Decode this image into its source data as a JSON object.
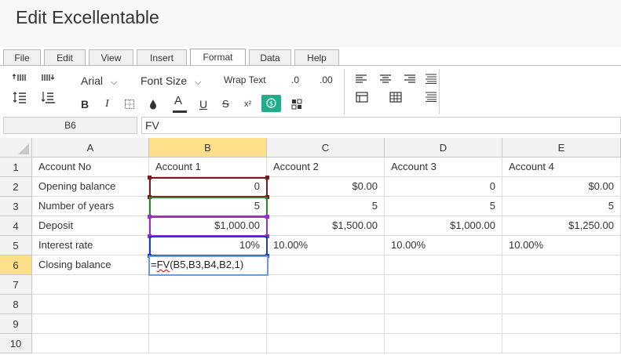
{
  "app": {
    "title": "Edit Excellentable"
  },
  "tabs": [
    {
      "label": "File"
    },
    {
      "label": "Edit"
    },
    {
      "label": "View"
    },
    {
      "label": "Insert"
    },
    {
      "label": "Format",
      "active": true
    },
    {
      "label": "Data"
    },
    {
      "label": "Help"
    }
  ],
  "ribbon": {
    "font_name": "Arial",
    "font_size": "Font Size",
    "wrap_text": "Wrap Text",
    "dec_decrease": ".0",
    "dec_increase": ".00",
    "bold": "B",
    "italic": "I",
    "text_color": "A",
    "underline": "U",
    "strike": "S",
    "superscript": "x²",
    "accent_color": "#1fae8c"
  },
  "formula_bar": {
    "cell_ref": "B6",
    "value": "FV"
  },
  "grid": {
    "columns": [
      "A",
      "B",
      "C",
      "D",
      "E"
    ],
    "selected_column": "B",
    "rows": [
      "1",
      "2",
      "3",
      "4",
      "5",
      "6",
      "7",
      "8",
      "9",
      "10"
    ],
    "selected_row": "6",
    "data": [
      [
        "Account No",
        "Account 1",
        "Account 2",
        "Account 3",
        "Account 4"
      ],
      [
        "Opening balance",
        "0",
        "$0.00",
        "0",
        "$0.00"
      ],
      [
        "Number of years",
        "5",
        "5",
        "5",
        "5"
      ],
      [
        "Deposit",
        "$1,000.00",
        "$1,500.00",
        "$1,000.00",
        "$1,250.00"
      ],
      [
        "Interest rate",
        "10%",
        "10.00%",
        "10.00%",
        "10.00%"
      ],
      [
        "Closing balance",
        "",
        "",
        "",
        ""
      ],
      [
        "",
        "",
        "",
        "",
        ""
      ],
      [
        "",
        "",
        "",
        "",
        ""
      ],
      [
        "",
        "",
        "",
        "",
        ""
      ],
      [
        "",
        "",
        "",
        "",
        ""
      ]
    ],
    "editor": {
      "prefix": "=",
      "func": "FV",
      "args": "(B5,B3,B4,B2,1)"
    }
  }
}
